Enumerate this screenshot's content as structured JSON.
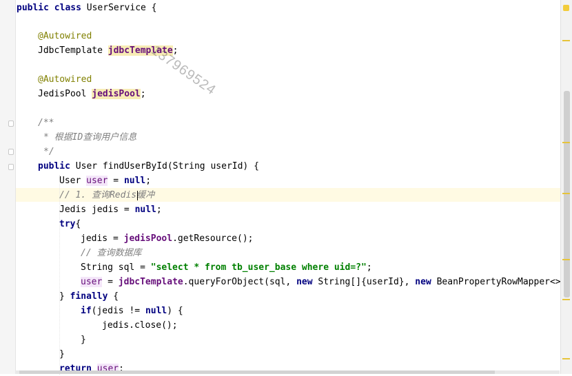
{
  "editor": {
    "watermark": "137969524",
    "colors": {
      "keyword": "#000080",
      "annotation": "#808000",
      "field": "#660e7a",
      "comment": "#808080",
      "string": "#008000",
      "current_line": "#fffae3"
    },
    "lines": [
      [
        "public",
        " ",
        "class",
        " UserService {"
      ],
      [
        "@Autowired"
      ],
      [
        "JdbcTemplate ",
        "jdbcTemplate",
        ";"
      ],
      [
        "@Autowired"
      ],
      [
        "JedisPool ",
        "jedisPool",
        ";"
      ],
      [
        "/**"
      ],
      [
        "* 根据ID查询用户信息"
      ],
      [
        "*/"
      ],
      [
        "public",
        " User findUserById(String userId) {"
      ],
      [
        "User ",
        "user",
        " = ",
        "null",
        ";"
      ],
      [
        "// 1. 查询Redis缓冲"
      ],
      [
        "Jedis jedis = ",
        "null",
        ";"
      ],
      [
        "try",
        "{"
      ],
      [
        "jedis = ",
        "jedisPool",
        ".getResource();"
      ],
      [
        "// 查询数据库"
      ],
      [
        "String sql = ",
        "\"select * from tb_user_base where uid=?\"",
        ";"
      ],
      [
        "user",
        " = ",
        "jdbcTemplate",
        ".queryForObject(sql, ",
        "new",
        " String[]{userId}, ",
        "new",
        " BeanPropertyRowMapper<>(U"
      ],
      [
        "} ",
        "finally",
        " {"
      ],
      [
        "if",
        "(jedis != ",
        "null",
        ") {"
      ],
      [
        "jedis.close();"
      ],
      [
        "}"
      ],
      [
        "}"
      ],
      [
        "return",
        " ",
        "user",
        ";"
      ]
    ]
  }
}
